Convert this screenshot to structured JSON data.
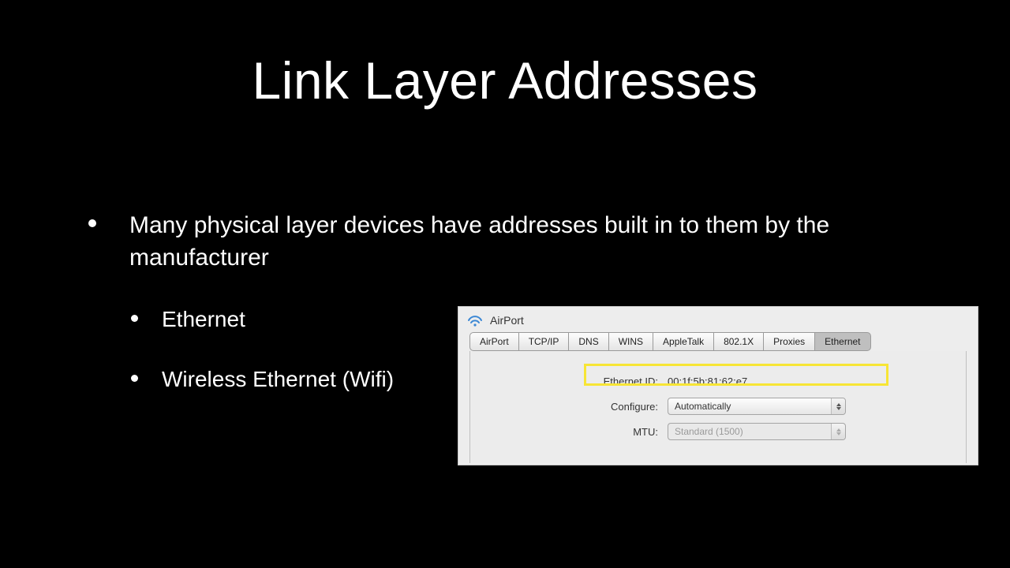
{
  "title": "Link Layer Addresses",
  "bullets": {
    "main": "Many physical layer devices have addresses built in to them by the manufacturer",
    "sub1": "Ethernet",
    "sub2": "Wireless Ethernet (Wifi)"
  },
  "panel": {
    "header": "AirPort",
    "tabs": [
      "AirPort",
      "TCP/IP",
      "DNS",
      "WINS",
      "AppleTalk",
      "802.1X",
      "Proxies",
      "Ethernet"
    ],
    "active_tab": "Ethernet",
    "rows": {
      "ethernet_id": {
        "label": "Ethernet ID:",
        "value": "00:1f:5b:81:62:e7"
      },
      "configure": {
        "label": "Configure:",
        "value": "Automatically"
      },
      "mtu": {
        "label": "MTU:",
        "value": "Standard (1500)"
      }
    }
  }
}
